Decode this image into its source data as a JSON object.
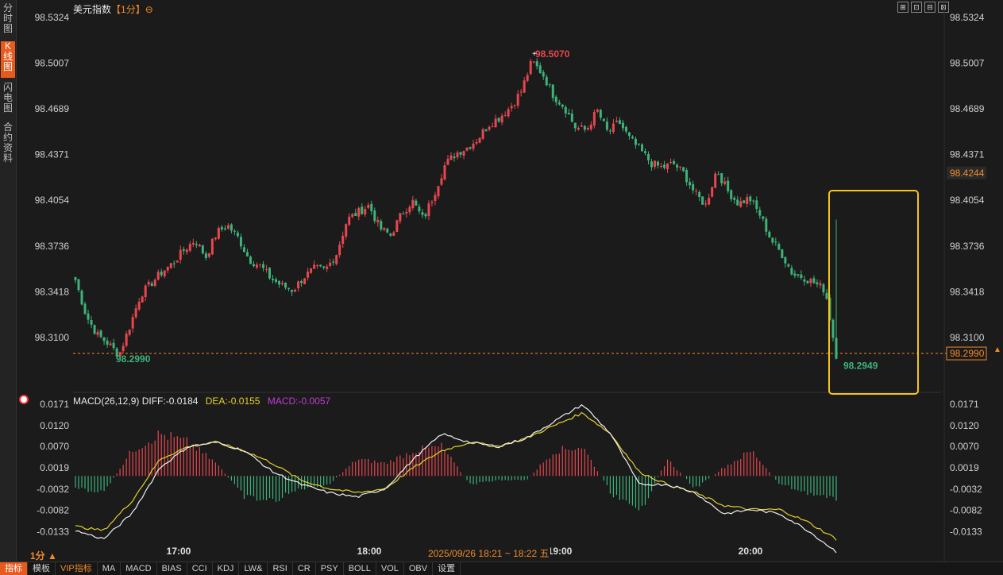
{
  "left_tabs": [
    {
      "label": "分时图",
      "active": false
    },
    {
      "label": "K线图",
      "active": true
    },
    {
      "label": "闪电图",
      "active": false
    },
    {
      "label": "合约资料",
      "active": false
    }
  ],
  "title": {
    "name": "美元指数",
    "period": "【1分】",
    "icon": "⊖"
  },
  "window_buttons": [
    "⊞",
    "⊡",
    "⊟",
    "⊠"
  ],
  "price_axis": {
    "ticks": [
      "98.5324",
      "98.5007",
      "98.4689",
      "98.4371",
      "98.4054",
      "98.3736",
      "98.3418",
      "98.3100"
    ],
    "current_price": "98.4244",
    "low_line_price": "98.2990"
  },
  "annotations": {
    "high": "98.5070",
    "low_left": "98.2990",
    "low_right": "98.2949"
  },
  "macd": {
    "label": "MACD(26,12,9)",
    "diff": "DIFF:-0.0184",
    "dea": "DEA:-0.0155",
    "macd": "MACD:-0.0057",
    "ticks": [
      "0.0171",
      "0.0120",
      "0.0070",
      "0.0019",
      "-0.0032",
      "-0.0082",
      "-0.0133"
    ]
  },
  "time_axis": [
    "17:00",
    "18:00",
    "19:00",
    "20:00"
  ],
  "period_label": "1分 ▲",
  "timestamp": "2025/09/26 18:21 ~ 18:22 五",
  "bottom_tabs": [
    "指标",
    "模板",
    "VIP指标",
    "MA",
    "MACD",
    "BIAS",
    "CCI",
    "KDJ",
    "LW&",
    "RSI",
    "CR",
    "PSY",
    "BOLL",
    "VOL",
    "OBV",
    "设置"
  ],
  "colors": {
    "up": "#e8474f",
    "down": "#3db37a",
    "background": "#1b1b1b",
    "accent": "#f08a2a",
    "highlight_box": "#f5c518"
  },
  "chart_data": {
    "type": "candlestick",
    "y_range": [
      98.288,
      98.5324
    ],
    "x_time_ticks": [
      "17:00",
      "18:00",
      "19:00",
      "20:00"
    ],
    "close_path": [
      98.35,
      98.325,
      98.312,
      98.306,
      98.298,
      98.318,
      98.34,
      98.348,
      98.356,
      98.362,
      98.371,
      98.378,
      98.366,
      98.383,
      98.388,
      98.379,
      98.364,
      98.36,
      98.351,
      98.346,
      98.343,
      98.352,
      98.358,
      98.357,
      98.368,
      98.392,
      98.397,
      98.402,
      98.386,
      98.381,
      98.396,
      98.405,
      98.392,
      98.41,
      98.43,
      98.438,
      98.442,
      98.448,
      98.458,
      98.463,
      98.47,
      98.481,
      98.502,
      98.493,
      98.478,
      98.47,
      98.456,
      98.454,
      98.468,
      98.452,
      98.46,
      98.448,
      98.44,
      98.431,
      98.428,
      98.431,
      98.424,
      98.41,
      98.402,
      98.427,
      98.412,
      98.403,
      98.407,
      98.395,
      98.378,
      98.368,
      98.354,
      98.352,
      98.348,
      98.343,
      98.297
    ],
    "last_price": 98.299,
    "high": 98.507,
    "low": 98.2949,
    "macd_range": [
      -0.016,
      0.018
    ],
    "diff_path": [
      -0.013,
      -0.015,
      -0.009,
      0.002,
      0.007,
      0.008,
      0.006,
      0.001,
      -0.002,
      -0.004,
      -0.005,
      -0.003,
      0.004,
      0.01,
      0.008,
      0.007,
      0.009,
      0.013,
      0.017,
      0.01,
      -0.002,
      -0.002,
      -0.004,
      -0.009,
      -0.008,
      -0.009,
      -0.013,
      -0.018
    ],
    "dea_path": [
      -0.012,
      -0.013,
      -0.006,
      0.004,
      0.007,
      0.008,
      0.006,
      0.003,
      -0.001,
      -0.003,
      -0.004,
      -0.003,
      0.002,
      0.006,
      0.008,
      0.007,
      0.009,
      0.012,
      0.015,
      0.01,
      0.001,
      -0.002,
      -0.004,
      -0.007,
      -0.008,
      -0.008,
      -0.011,
      -0.015
    ],
    "hist_path": [
      -0.003,
      -0.004,
      0.006,
      0.01,
      0.008,
      0.003,
      -0.005,
      -0.006,
      -0.003,
      -0.002,
      0.004,
      0.003,
      0.006,
      0.007,
      -0.002,
      -0.001,
      -0.001,
      0.006,
      0.007,
      -0.004,
      -0.009,
      0.004,
      -0.003,
      0.002,
      0.006,
      -0.002,
      -0.004,
      -0.006
    ]
  }
}
